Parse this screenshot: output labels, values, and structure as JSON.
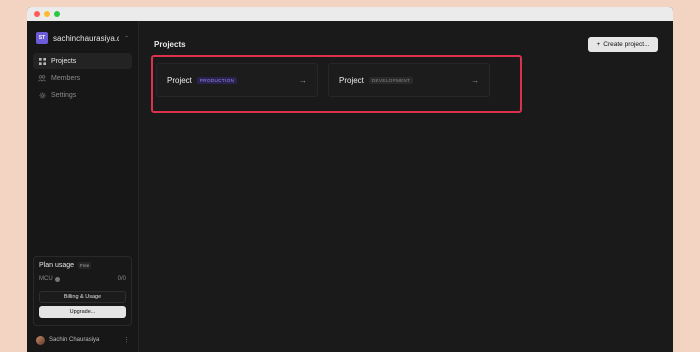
{
  "window": {
    "controls": [
      {
        "name": "close",
        "color": "#ff5f57"
      },
      {
        "name": "minimize",
        "color": "#febc2e"
      },
      {
        "name": "zoom",
        "color": "#28c840"
      }
    ]
  },
  "sidebar": {
    "org": {
      "initials": "ST",
      "name": "sachinchaurasiya.d...",
      "avatar_color": "#6b5bd6"
    },
    "nav": [
      {
        "label": "Projects",
        "icon": "grid-icon",
        "active": true
      },
      {
        "label": "Members",
        "icon": "users-icon",
        "active": false
      },
      {
        "label": "Settings",
        "icon": "gear-icon",
        "active": false
      }
    ],
    "plan": {
      "title": "Plan usage",
      "tier": "Free",
      "metric_label": "MCU",
      "metric_value": "0/0",
      "billing_label": "Billing & Usage",
      "upgrade_label": "Upgrade..."
    },
    "user": {
      "name": "Sachin Chaurasiya"
    }
  },
  "main": {
    "title": "Projects",
    "create_button": {
      "icon": "plus-icon",
      "label": "Create project..."
    },
    "projects": [
      {
        "name": "Project",
        "environment": "PRODUCTION",
        "badge_color": "#9b8cf0"
      },
      {
        "name": "Project",
        "environment": "DEVELOPMENT",
        "badge_color": "#8a8a8a"
      }
    ],
    "highlight_color": "#d8324d"
  }
}
